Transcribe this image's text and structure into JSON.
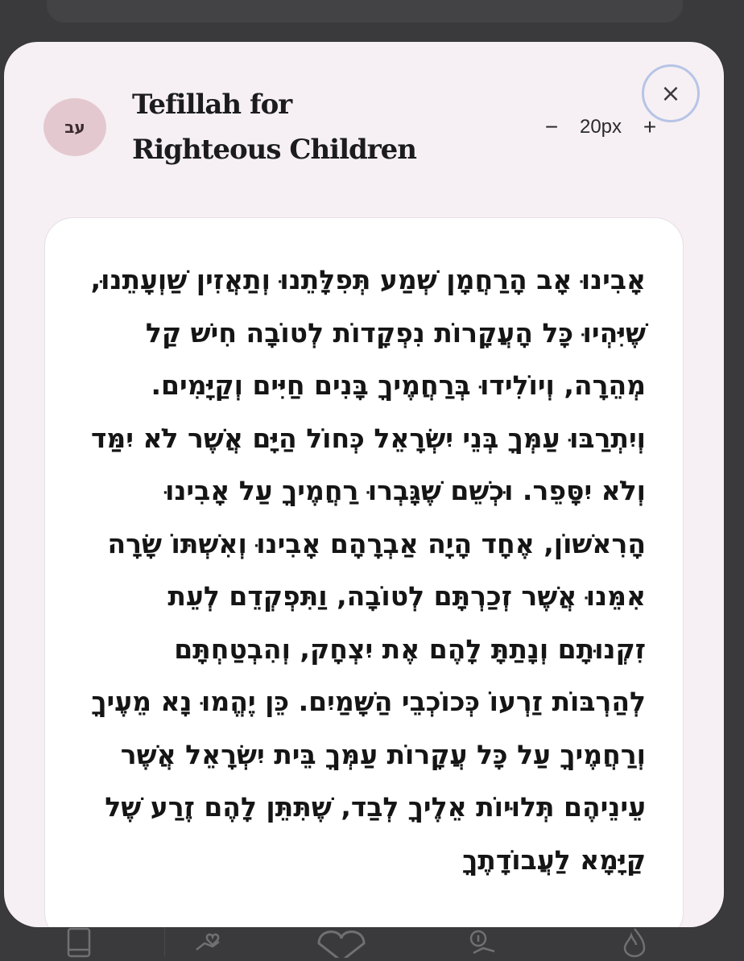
{
  "sheet": {
    "language_badge": "עב",
    "title": "Tefillah for Righteous Children",
    "font_size": {
      "decrease_label": "−",
      "value": "20px",
      "increase_label": "+"
    },
    "close_label": "×",
    "prayer_text": "אָבִינוּ אָב הָרַחֲמָן שְׁמַע תְּפִלָּתֵנוּ וְתַאֲזִין שַׁוְעָתֵנוּ, שֶׁיִּהְיוּ כָּל הָעֲקָרוֹת נִפְקָדוֹת לְטוֹבָה חִישׁ קַל מְהֵרָה, וְיוֹלִידוּ בְּרַחֲמֶיךָ בָּנִים חַיִּים וְקַיָּמִים. וְיִתְרַבּוּ עַמְּךָ בְּנֵי יִשְׂרָאֵל כְּחוֹל הַיָּם אֲשֶׁר לֹא יִמַּד וְלֹא יִסָּפֵר. וּכְשֵׁם שֶׁגָּבְרוּ רַחֲמֶיךָ עַל אָבִינוּ הָרִאשׁוֹן, אֶחָד הָיָה אַבְרָהָם אָבִינוּ וְאִשְׁתּוֹ שָׂרָה אִמֵּנוּ אֲשֶׁר זְכַרְתָּם לְטוֹבָה, וַתִּפְקְדֵם לְעֵת זִקְנוּתָם וְנָתַתָּ לָהֶם אֶת יִצְחָק, וְהִבְטַחְתָּם לְהַרְבּוֹת זַרְעוֹ כְּכוֹכְבֵי הַשָּׁמַיִם. כֵּן יֶהֱמוּ נָא מֵעֶיךָ וְרַחֲמֶיךָ עַל כָּל עֲקָרוֹת עַמְּךָ בֵּית יִשְׂרָאֵל אֲשֶׁר עֵינֵיהֶם תְּלוּיוֹת אֵלֶיךָ לְבַד, שֶׁתִּתֵּן לָהֶם זֶרַע שֶׁל קַיָּמָא לַעֲבוֹדָתֶךָ"
  },
  "tab_bar": {
    "icons": [
      "book-icon",
      "hand-heart-icon",
      "heart-icon",
      "coin-hand-icon",
      "flame-icon"
    ]
  }
}
